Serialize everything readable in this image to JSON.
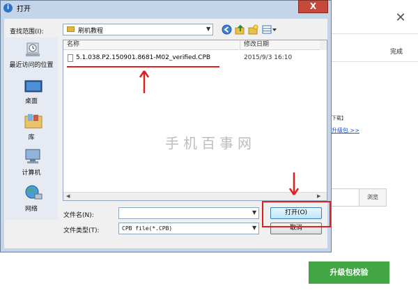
{
  "background_app": {
    "close_glyph": "✕",
    "done_text": "完成",
    "download_text": "下载】",
    "link_text": "升级包 >>",
    "browse_label": "浏览",
    "verify_button": "升级包校验",
    "colors": {
      "verify_button": "#43a644",
      "link": "#1a4fd6"
    }
  },
  "dialog": {
    "title": "打开",
    "title_icon": "i",
    "close_glyph": "X",
    "look_in_label": "查找范围(I):",
    "look_in_value": "刷机教程",
    "toolbar": {
      "back_icon": "back-arrow",
      "up_icon": "up-folder",
      "new_folder_icon": "new-folder",
      "view_icon": "view-menu"
    },
    "places": [
      {
        "label": "最近访问的位置",
        "icon": "recent-places-icon"
      },
      {
        "label": "桌面",
        "icon": "desktop-icon"
      },
      {
        "label": "库",
        "icon": "library-icon"
      },
      {
        "label": "计算机",
        "icon": "computer-icon"
      },
      {
        "label": "网络",
        "icon": "network-icon"
      }
    ],
    "columns": {
      "name": "名称",
      "modified": "修改日期"
    },
    "files": [
      {
        "name": "5.1.038.P2.150901.8681-M02_verified.CPB",
        "modified": "2015/9/3 16:10"
      }
    ],
    "watermark": "手机百事网",
    "file_name_label": "文件名(N):",
    "file_name_value": "",
    "file_type_label": "文件类型(T):",
    "file_type_value": "CPB file(*.CPB)",
    "open_button": "打开(O)",
    "cancel_button": "取消",
    "colors": {
      "annotation": "#e02020",
      "title_close": "#c7493c"
    }
  }
}
